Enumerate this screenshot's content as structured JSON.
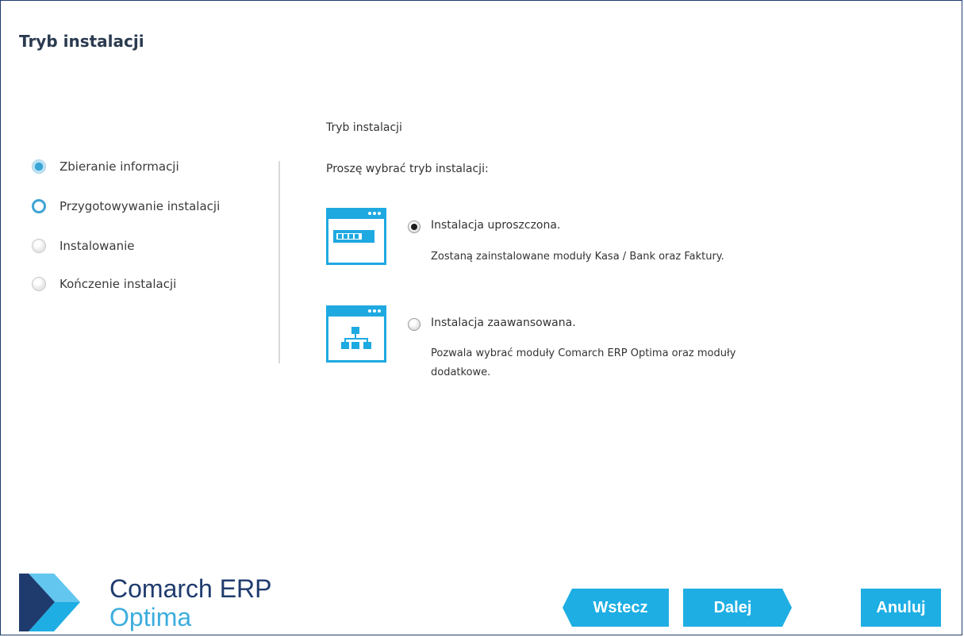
{
  "window": {
    "title": "Tryb instalacji"
  },
  "steps": [
    {
      "label": "Zbieranie informacji",
      "state": "done"
    },
    {
      "label": "Przygotowywanie instalacji",
      "state": "active"
    },
    {
      "label": "Instalowanie",
      "state": "pending"
    },
    {
      "label": "Kończenie instalacji",
      "state": "pending"
    }
  ],
  "main": {
    "section_title": "Tryb instalacji",
    "prompt": "Proszę wybrać tryb instalacji:",
    "options": [
      {
        "label": "Instalacja uproszczona.",
        "description": "Zostaną zainstalowane moduły Kasa / Bank oraz Faktury.",
        "selected": true,
        "icon": "simple-install-window-icon"
      },
      {
        "label": "Instalacja zaawansowana.",
        "description": "Pozwala wybrać moduły Comarch ERP Optima oraz moduły dodatkowe.",
        "selected": false,
        "icon": "advanced-install-window-icon"
      }
    ]
  },
  "logo": {
    "line1": "Comarch ERP",
    "line2": "Optima"
  },
  "buttons": {
    "back": "Wstecz",
    "next": "Dalej",
    "cancel": "Anuluj"
  },
  "colors": {
    "accent": "#1eaee4",
    "navy": "#1f3b6e",
    "light_blue": "#3cadde"
  }
}
